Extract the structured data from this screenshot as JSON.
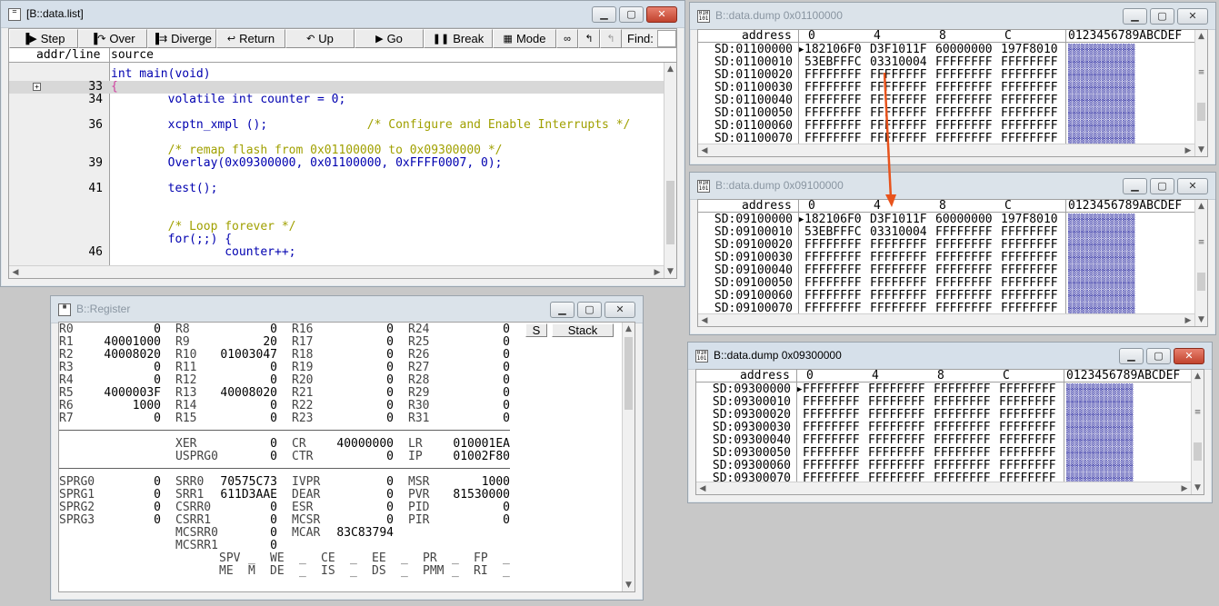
{
  "list_window": {
    "title": "[B::data.list]",
    "toolbar": [
      {
        "label": "Step",
        "icon": "step-icon"
      },
      {
        "label": "Over",
        "icon": "over-icon"
      },
      {
        "label": "Diverge",
        "icon": "diverge-icon"
      },
      {
        "label": "Return",
        "icon": "return-icon"
      },
      {
        "label": "Up",
        "icon": "up-icon"
      },
      {
        "label": "Go",
        "icon": "go-icon"
      },
      {
        "label": "Break",
        "icon": "break-icon"
      },
      {
        "label": "Mode",
        "icon": "mode-icon"
      }
    ],
    "find_label": "Find:",
    "headers": {
      "addr_line": "addr/line",
      "source": "source"
    },
    "lines": [
      {
        "num": "",
        "src": "int main(void)"
      },
      {
        "num": "33",
        "src": "{"
      },
      {
        "num": "34",
        "src": "        volatile int counter = 0;"
      },
      {
        "num": "",
        "src": ""
      },
      {
        "num": "36",
        "src": "        xcptn_xmpl ();              /* Configure and Enable Interrupts */"
      },
      {
        "num": "",
        "src": ""
      },
      {
        "num": "",
        "src": "        /* remap flash from 0x01100000 to 0x09300000 */"
      },
      {
        "num": "39",
        "src": "        Overlay(0x09300000, 0x01100000, 0xFFFF0007, 0);"
      },
      {
        "num": "",
        "src": ""
      },
      {
        "num": "41",
        "src": "        test();"
      },
      {
        "num": "",
        "src": ""
      },
      {
        "num": "",
        "src": ""
      },
      {
        "num": "",
        "src": "        /* Loop forever */"
      },
      {
        "num": "",
        "src": "        for(;;) {"
      },
      {
        "num": "46",
        "src": "                counter++;"
      }
    ]
  },
  "dump1": {
    "title": "B::data.dump 0x01100000",
    "headers": {
      "address": "address",
      "c0": "0",
      "c4": "4",
      "c8": "8",
      "cc": "C",
      "ascii": "0123456789ABCDEF"
    },
    "rows": [
      {
        "addr": "SD:01100000",
        "v": [
          "182106F0",
          "D3F1011F",
          "60000000",
          "197F8010"
        ],
        "cur": true
      },
      {
        "addr": "SD:01100010",
        "v": [
          "53EBFFFC",
          "03310004",
          "FFFFFFFF",
          "FFFFFFFF"
        ]
      },
      {
        "addr": "SD:01100020",
        "v": [
          "FFFFFFFF",
          "FFFFFFFF",
          "FFFFFFFF",
          "FFFFFFFF"
        ]
      },
      {
        "addr": "SD:01100030",
        "v": [
          "FFFFFFFF",
          "FFFFFFFF",
          "FFFFFFFF",
          "FFFFFFFF"
        ]
      },
      {
        "addr": "SD:01100040",
        "v": [
          "FFFFFFFF",
          "FFFFFFFF",
          "FFFFFFFF",
          "FFFFFFFF"
        ]
      },
      {
        "addr": "SD:01100050",
        "v": [
          "FFFFFFFF",
          "FFFFFFFF",
          "FFFFFFFF",
          "FFFFFFFF"
        ]
      },
      {
        "addr": "SD:01100060",
        "v": [
          "FFFFFFFF",
          "FFFFFFFF",
          "FFFFFFFF",
          "FFFFFFFF"
        ]
      },
      {
        "addr": "SD:01100070",
        "v": [
          "FFFFFFFF",
          "FFFFFFFF",
          "FFFFFFFF",
          "FFFFFFFF"
        ]
      }
    ]
  },
  "dump2": {
    "title": "B::data.dump 0x09100000",
    "headers": {
      "address": "address",
      "c0": "0",
      "c4": "4",
      "c8": "8",
      "cc": "C",
      "ascii": "0123456789ABCDEF"
    },
    "rows": [
      {
        "addr": "SD:09100000",
        "v": [
          "182106F0",
          "D3F1011F",
          "60000000",
          "197F8010"
        ],
        "cur": true
      },
      {
        "addr": "SD:09100010",
        "v": [
          "53EBFFFC",
          "03310004",
          "FFFFFFFF",
          "FFFFFFFF"
        ]
      },
      {
        "addr": "SD:09100020",
        "v": [
          "FFFFFFFF",
          "FFFFFFFF",
          "FFFFFFFF",
          "FFFFFFFF"
        ]
      },
      {
        "addr": "SD:09100030",
        "v": [
          "FFFFFFFF",
          "FFFFFFFF",
          "FFFFFFFF",
          "FFFFFFFF"
        ]
      },
      {
        "addr": "SD:09100040",
        "v": [
          "FFFFFFFF",
          "FFFFFFFF",
          "FFFFFFFF",
          "FFFFFFFF"
        ]
      },
      {
        "addr": "SD:09100050",
        "v": [
          "FFFFFFFF",
          "FFFFFFFF",
          "FFFFFFFF",
          "FFFFFFFF"
        ]
      },
      {
        "addr": "SD:09100060",
        "v": [
          "FFFFFFFF",
          "FFFFFFFF",
          "FFFFFFFF",
          "FFFFFFFF"
        ]
      },
      {
        "addr": "SD:09100070",
        "v": [
          "FFFFFFFF",
          "FFFFFFFF",
          "FFFFFFFF",
          "FFFFFFFF"
        ]
      }
    ]
  },
  "dump3": {
    "title": "B::data.dump 0x09300000",
    "headers": {
      "address": "address",
      "c0": "0",
      "c4": "4",
      "c8": "8",
      "cc": "C",
      "ascii": "0123456789ABCDEF"
    },
    "rows": [
      {
        "addr": "SD:09300000",
        "v": [
          "FFFFFFFF",
          "FFFFFFFF",
          "FFFFFFFF",
          "FFFFFFFF"
        ],
        "cur": true
      },
      {
        "addr": "SD:09300010",
        "v": [
          "FFFFFFFF",
          "FFFFFFFF",
          "FFFFFFFF",
          "FFFFFFFF"
        ]
      },
      {
        "addr": "SD:09300020",
        "v": [
          "FFFFFFFF",
          "FFFFFFFF",
          "FFFFFFFF",
          "FFFFFFFF"
        ]
      },
      {
        "addr": "SD:09300030",
        "v": [
          "FFFFFFFF",
          "FFFFFFFF",
          "FFFFFFFF",
          "FFFFFFFF"
        ]
      },
      {
        "addr": "SD:09300040",
        "v": [
          "FFFFFFFF",
          "FFFFFFFF",
          "FFFFFFFF",
          "FFFFFFFF"
        ]
      },
      {
        "addr": "SD:09300050",
        "v": [
          "FFFFFFFF",
          "FFFFFFFF",
          "FFFFFFFF",
          "FFFFFFFF"
        ]
      },
      {
        "addr": "SD:09300060",
        "v": [
          "FFFFFFFF",
          "FFFFFFFF",
          "FFFFFFFF",
          "FFFFFFFF"
        ]
      },
      {
        "addr": "SD:09300070",
        "v": [
          "FFFFFFFF",
          "FFFFFFFF",
          "FFFFFFFF",
          "FFFFFFFF"
        ]
      }
    ]
  },
  "register": {
    "title": "B::Register",
    "buttons": {
      "s": "S",
      "stack": "Stack"
    },
    "gpr": [
      [
        "R0",
        "0",
        "R8",
        "0",
        "R16",
        "0",
        "R24",
        "0"
      ],
      [
        "R1",
        "40001000",
        "R9",
        "20",
        "R17",
        "0",
        "R25",
        "0"
      ],
      [
        "R2",
        "40008020",
        "R10",
        "01003047",
        "R18",
        "0",
        "R26",
        "0"
      ],
      [
        "R3",
        "0",
        "R11",
        "0",
        "R19",
        "0",
        "R27",
        "0"
      ],
      [
        "R4",
        "0",
        "R12",
        "0",
        "R20",
        "0",
        "R28",
        "0"
      ],
      [
        "R5",
        "4000003F",
        "R13",
        "40008020",
        "R21",
        "0",
        "R29",
        "0"
      ],
      [
        "R6",
        "1000",
        "R14",
        "0",
        "R22",
        "0",
        "R30",
        "0"
      ],
      [
        "R7",
        "0",
        "R15",
        "0",
        "R23",
        "0",
        "R31",
        "0"
      ]
    ],
    "spr1": [
      [
        "",
        "",
        "XER",
        "0",
        "CR",
        "40000000",
        "LR",
        "010001EA"
      ],
      [
        "",
        "",
        "USPRG0",
        "0",
        "CTR",
        "0",
        "IP",
        "01002F80"
      ]
    ],
    "spr2": [
      [
        "SPRG0",
        "0",
        "SRR0",
        "70575C73",
        "IVPR",
        "0",
        "MSR",
        "1000"
      ],
      [
        "SPRG1",
        "0",
        "SRR1",
        "611D3AAE",
        "DEAR",
        "0",
        "PVR",
        "81530000"
      ],
      [
        "SPRG2",
        "0",
        "CSRR0",
        "0",
        "ESR",
        "0",
        "PID",
        "0"
      ],
      [
        "SPRG3",
        "0",
        "CSRR1",
        "0",
        "MCSR",
        "0",
        "PIR",
        "0"
      ],
      [
        "",
        "",
        "MCSRR0",
        "0",
        "MCAR",
        "83C83794",
        "",
        ""
      ],
      [
        "",
        "",
        "MCSRR1",
        "0",
        "",
        "",
        "",
        ""
      ]
    ],
    "flags_top": [
      "SPV",
      "_",
      "WE",
      "_",
      "CE",
      "_",
      "EE",
      "_",
      "PR",
      "_",
      "FP",
      "_"
    ],
    "flags_bot": [
      "ME",
      "M",
      "DE",
      "_",
      "IS",
      "_",
      "DS",
      "_",
      "PMM",
      "_",
      "RI",
      "_"
    ]
  }
}
